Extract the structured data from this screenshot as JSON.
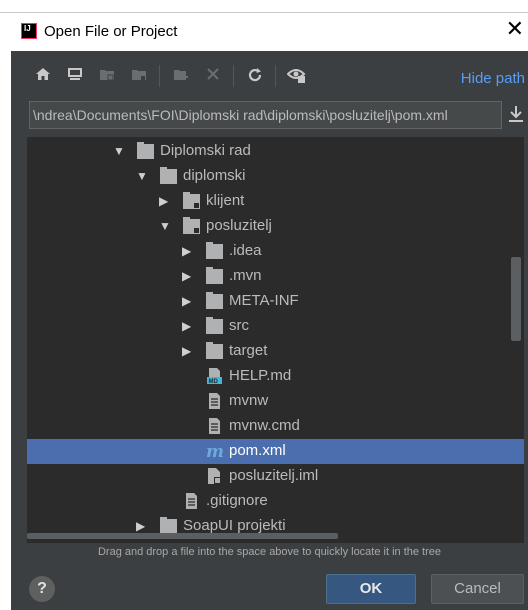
{
  "window": {
    "title": "Open File or Project",
    "close_glyph": "✕"
  },
  "toolbar": {
    "hide_path_label": "Hide path",
    "icons": [
      "home-icon",
      "desktop-icon",
      "project-icon",
      "module-icon",
      "new-folder-icon",
      "delete-icon",
      "refresh-icon",
      "show-hidden-icon"
    ]
  },
  "path": {
    "value": "\\ndrea\\Documents\\FOI\\Diplomski rad\\diplomski\\posluzitelj\\pom.xml"
  },
  "tree": {
    "rows": [
      {
        "label": "Diplomski rad",
        "type": "folder",
        "expanded": true,
        "depth": 0
      },
      {
        "label": "diplomski",
        "type": "folder",
        "expanded": true,
        "depth": 1
      },
      {
        "label": "klijent",
        "type": "module",
        "expanded": false,
        "depth": 2
      },
      {
        "label": "posluzitelj",
        "type": "module",
        "expanded": true,
        "depth": 2
      },
      {
        "label": ".idea",
        "type": "folder",
        "expanded": false,
        "depth": 3
      },
      {
        "label": ".mvn",
        "type": "folder",
        "expanded": false,
        "depth": 3
      },
      {
        "label": "META-INF",
        "type": "folder",
        "expanded": false,
        "depth": 3
      },
      {
        "label": "src",
        "type": "folder",
        "expanded": false,
        "depth": 3
      },
      {
        "label": "target",
        "type": "folder",
        "expanded": false,
        "depth": 3
      },
      {
        "label": "HELP.md",
        "type": "markdown",
        "depth": 3
      },
      {
        "label": "mvnw",
        "type": "text",
        "depth": 3
      },
      {
        "label": "mvnw.cmd",
        "type": "text",
        "depth": 3
      },
      {
        "label": "pom.xml",
        "type": "maven",
        "depth": 3,
        "selected": true
      },
      {
        "label": "posluzitelj.iml",
        "type": "iml",
        "depth": 3
      },
      {
        "label": ".gitignore",
        "type": "text",
        "depth": 2
      },
      {
        "label": "SoapUI projekti",
        "type": "folder",
        "expanded": false,
        "depth": 1
      }
    ]
  },
  "hint": "Drag and drop a file into the space above to quickly locate it in the tree",
  "buttons": {
    "help": "?",
    "ok": "OK",
    "cancel": "Cancel"
  },
  "colors": {
    "dialog_bg": "#3c3f41",
    "tree_bg": "#2b2b2b",
    "selection": "#4b6eaf",
    "link": "#589df6",
    "ok_button": "#365880"
  }
}
